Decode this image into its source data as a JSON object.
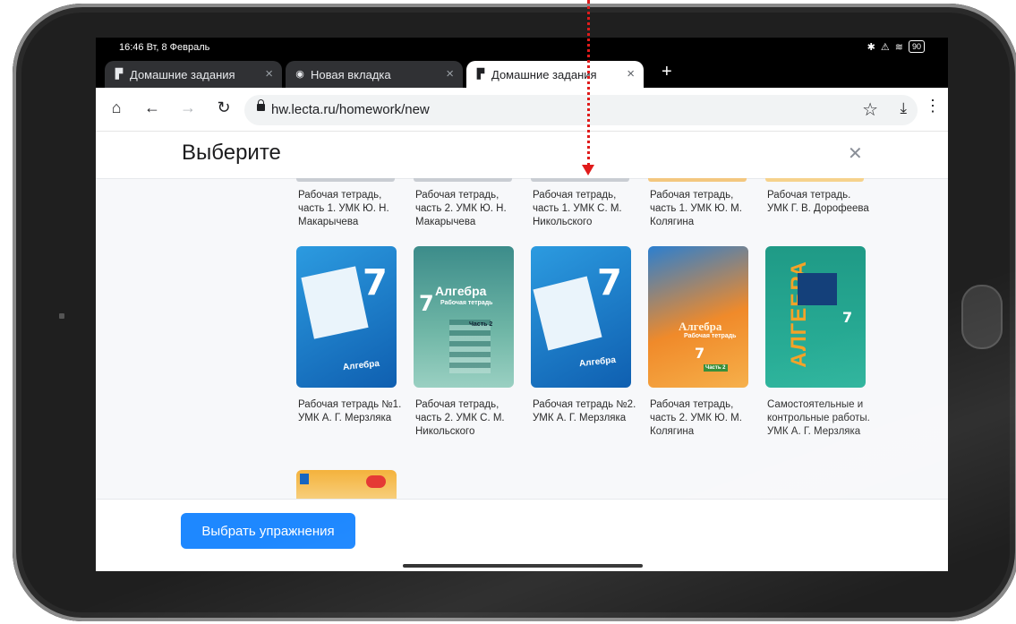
{
  "status_bar": {
    "time": "16:46 Вт, 8 Февраль",
    "battery": "90"
  },
  "tabs": [
    {
      "label": "Домашние задания",
      "active": false
    },
    {
      "label": "Новая вкладка",
      "active": false
    },
    {
      "label": "Домашние задания",
      "active": true
    }
  ],
  "toolbar": {
    "url": "hw.lecta.ru/homework/new"
  },
  "modal": {
    "title": "Выберите"
  },
  "books_row1": [
    "Рабочая тетрадь, часть 1. УМК Ю. Н. Макарычева",
    "Рабочая тетрадь, часть 2. УМК Ю. Н. Макарычева",
    "Рабочая тетрадь, часть 1. УМК С. М. Никольского",
    "Рабочая тетрадь, часть 1. УМК Ю. М. Колягина",
    "Рабочая тетрадь. УМК Г. В. Дорофеева"
  ],
  "books_row2": [
    "Рабочая тетрадь №1. УМК А. Г. Мерзляка",
    "Рабочая тетрадь, часть 2. УМК С. М. Никольского",
    "Рабочая тетрадь №2. УМК А. Г. Мерзляка",
    "Рабочая тетрадь, часть 2. УМК Ю. М. Колягина",
    "Самостоятельные и контрольные работы. УМК А. Г. Мерзляка"
  ],
  "covers": {
    "merzlyak_1": {
      "grade": "7",
      "word": "Алгебра"
    },
    "nikolsky_2": {
      "grade": "7",
      "word": "Алгебра",
      "sub": "Рабочая тетрадь",
      "part": "Часть 2"
    },
    "merzlyak_2": {
      "grade": "7",
      "word": "Алгебра"
    },
    "kolyagin_2": {
      "word": "Алгебра",
      "sub": "Рабочая тетрадь",
      "grade": "7",
      "part": "Часть 2"
    },
    "merzlyak_sk": {
      "word": "АЛГЕБРА",
      "grade": "7"
    }
  },
  "footer": {
    "button_label": "Выбрать упражнения"
  },
  "colors": {
    "accent": "#1e88ff",
    "annotation": "#e01b1b"
  }
}
